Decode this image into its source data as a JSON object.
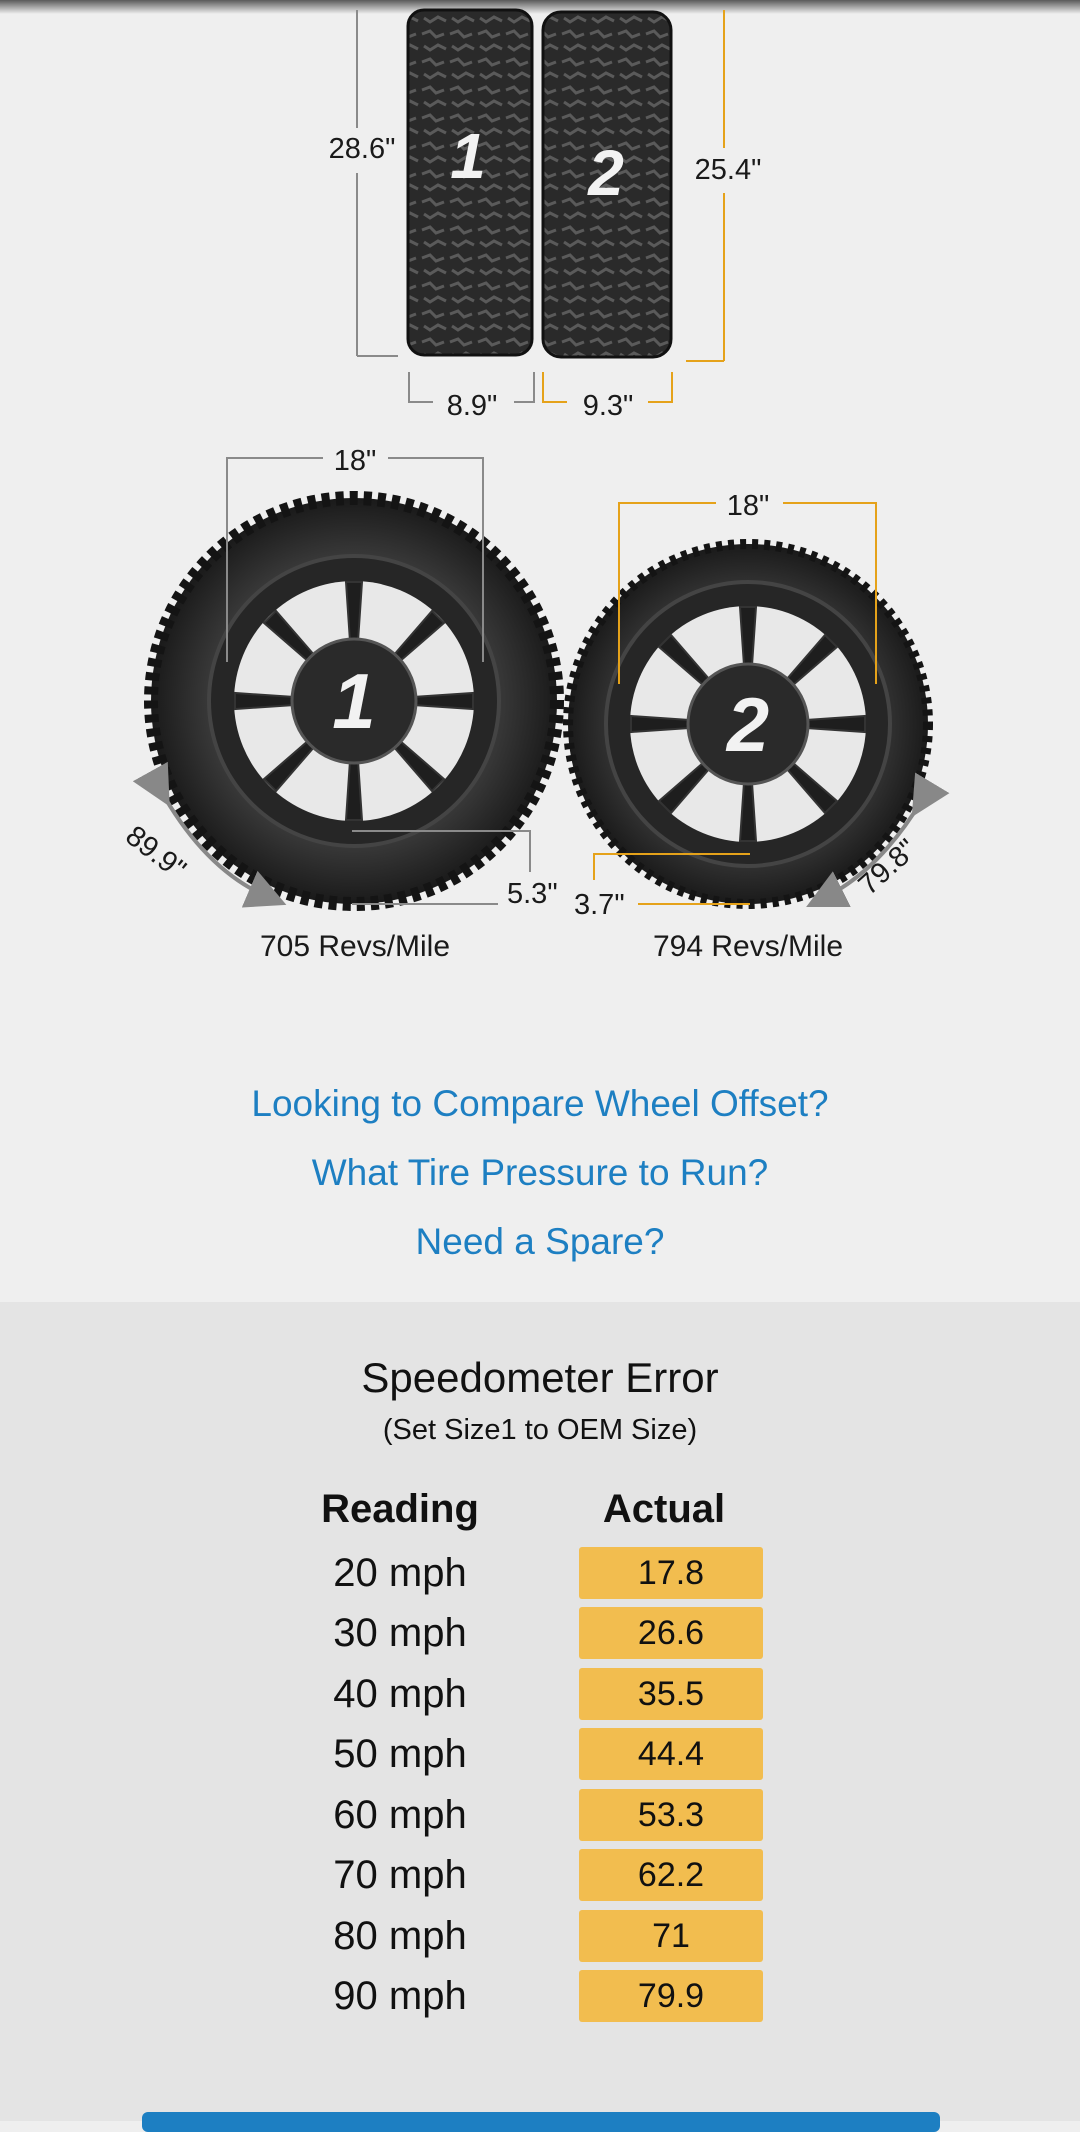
{
  "side_profile": {
    "tire1_height": "28.6\"",
    "tire2_height": "25.4\"",
    "tire1_width": "8.9\"",
    "tire2_width": "9.3\"",
    "tire1_number": "1",
    "tire2_number": "2"
  },
  "front_view": {
    "wheel1_rim": "18\"",
    "wheel2_rim": "18\"",
    "wheel1_circumference": "89.9\"",
    "wheel2_circumference": "79.8\"",
    "wheel1_sidewall": "5.3\"",
    "wheel2_sidewall": "3.7\"",
    "wheel1_revs": "705 Revs/Mile",
    "wheel2_revs": "794 Revs/Mile"
  },
  "links": {
    "offset": "Looking to Compare Wheel Offset?",
    "pressure": "What Tire Pressure to Run?",
    "spare": "Need a Spare?"
  },
  "speedometer": {
    "title": "Speedometer Error",
    "subtitle": "(Set Size1 to OEM Size)",
    "header_reading": "Reading",
    "header_actual": "Actual",
    "rows": [
      {
        "reading": "20 mph",
        "actual": "17.8"
      },
      {
        "reading": "30 mph",
        "actual": "26.6"
      },
      {
        "reading": "40 mph",
        "actual": "35.5"
      },
      {
        "reading": "50 mph",
        "actual": "44.4"
      },
      {
        "reading": "60 mph",
        "actual": "53.3"
      },
      {
        "reading": "70 mph",
        "actual": "62.2"
      },
      {
        "reading": "80 mph",
        "actual": "71"
      },
      {
        "reading": "90 mph",
        "actual": "79.9"
      }
    ]
  },
  "colors": {
    "accent_gold": "#f2bd4f",
    "link_blue": "#1d7fc2",
    "guide_gray": "#8a8a8a",
    "guide_gold": "#e5a21a"
  }
}
